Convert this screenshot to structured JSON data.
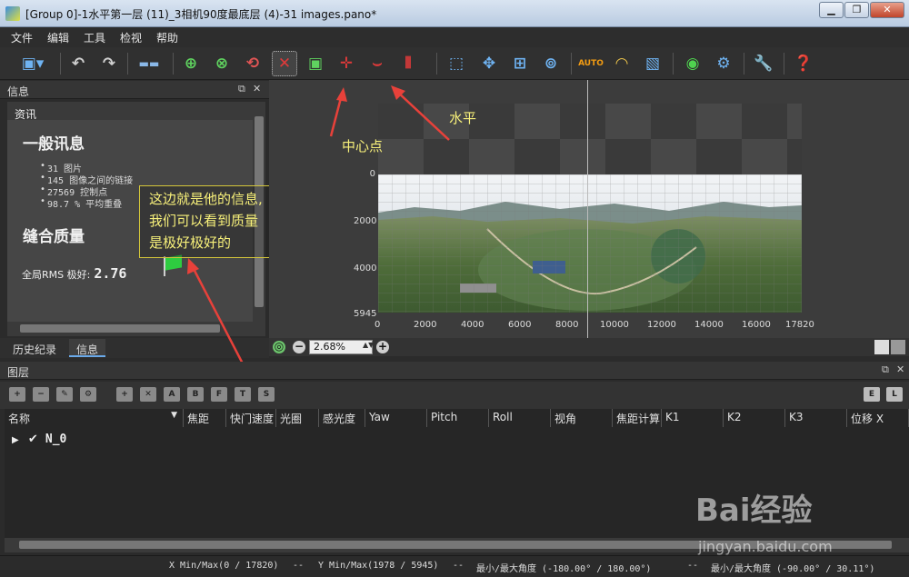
{
  "window": {
    "title": "[Group 0]-1水平第一层 (11)_3相机90度最底层 (4)-31 images.pano*",
    "minimize": "▁",
    "restore": "❐",
    "close": "✕"
  },
  "menu": [
    "文件",
    "编辑",
    "工具",
    "检视",
    "帮助"
  ],
  "info_panel": {
    "header": "信息",
    "section": "资讯",
    "general_heading": "一般讯息",
    "stats": [
      "31 图片",
      "145 图像之间的链接",
      "27569 控制点",
      "98.7 % 平均重叠"
    ],
    "quality_heading": "缝合质量",
    "rms_label": "全局RMS 极好:",
    "rms_value": "2.76"
  },
  "tabs": [
    "历史纪录",
    "信息"
  ],
  "annotation": {
    "callout_line1": "这边就是他的信息,",
    "callout_line2": "我们可以看到质量",
    "callout_line3": "是极好极好的",
    "center_label": "中心点",
    "horizon_label": "水平"
  },
  "view": {
    "y_ticks": [
      "0",
      "2000",
      "4000",
      "5945"
    ],
    "x_ticks": [
      "0",
      "2000",
      "4000",
      "6000",
      "8000",
      "10000",
      "12000",
      "14000",
      "16000",
      "17820"
    ],
    "zoom": "2.68%"
  },
  "layers": {
    "header": "图层",
    "columns": [
      "名称",
      "焦距",
      "快门速度",
      "光圈",
      "感光度",
      "Yaw",
      "Pitch",
      "Roll",
      "视角",
      "焦距计算",
      "K1",
      "K2",
      "K3",
      "位移 X"
    ],
    "row_name": "N_0",
    "tool_letters": [
      "A",
      "B",
      "F",
      "T",
      "S"
    ],
    "right_letters": [
      "E",
      "L"
    ]
  },
  "status": {
    "xminmax": "X Min/Max(0 / 17820)",
    "sep1": "--",
    "yminmax": "Y Min/Max(1978 / 5945)",
    "sep2": "--",
    "angle_h": "最小/最大角度 (-180.00° / 180.00°)",
    "sep3": "--",
    "angle_v": "最小/最大角度 (-90.00° / 30.11°)"
  },
  "watermark": {
    "logo": "Bai经验",
    "url": "jingyan.baidu.com"
  },
  "colors": {
    "accent_yellow": "#f7f07a",
    "arrow_red": "#e8413a",
    "flag_green": "#2ecc40"
  }
}
